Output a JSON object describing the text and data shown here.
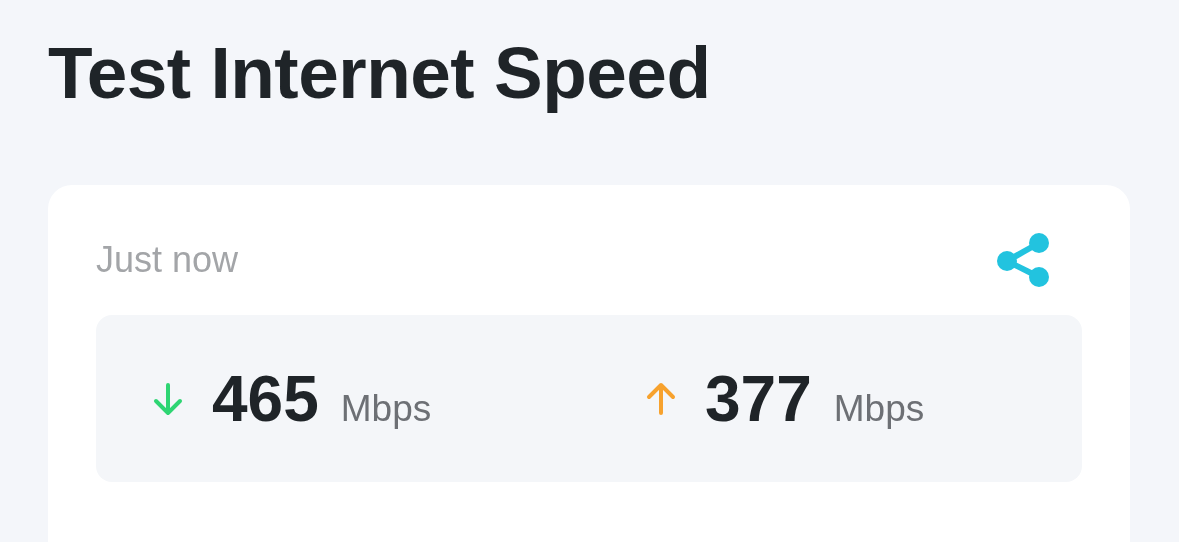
{
  "title": "Test Internet Speed",
  "card": {
    "timestamp": "Just now",
    "results": [
      {
        "kind": "download",
        "value": "465",
        "unit": "Mbps"
      },
      {
        "kind": "upload",
        "value": "377",
        "unit": "Mbps"
      }
    ]
  }
}
